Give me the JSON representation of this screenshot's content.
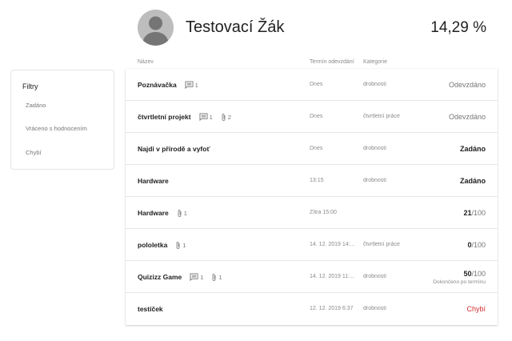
{
  "student": {
    "name": "Testovací Žák",
    "grade_percent": "14,29 %"
  },
  "filters": {
    "title": "Filtry",
    "items": [
      {
        "label": "Zadáno"
      },
      {
        "label": "Vráceno s hodnocením"
      },
      {
        "label": "Chybí"
      }
    ]
  },
  "table": {
    "headers": {
      "name": "Název",
      "due": "Termín odevzdání",
      "category": "Kategorie"
    },
    "rows": [
      {
        "name": "Poznávačka",
        "comments": "1",
        "attachments": "",
        "due": "Dnes",
        "category": "drobnosti",
        "status": "Odevzdáno",
        "status_type": "muted"
      },
      {
        "name": "čtvrtletní projekt",
        "comments": "1",
        "attachments": "2",
        "due": "Dnes",
        "category": "čtvrtletní práce",
        "status": "Odevzdáno",
        "status_type": "muted"
      },
      {
        "name": "Najdi v přírodě a vyfoť",
        "comments": "",
        "attachments": "",
        "due": "Dnes",
        "category": "drobnosti",
        "status": "Zadáno",
        "status_type": "strong"
      },
      {
        "name": "Hardware",
        "comments": "",
        "attachments": "",
        "due": "13:15",
        "category": "drobnosti",
        "status": "Zadáno",
        "status_type": "strong"
      },
      {
        "name": "Hardware",
        "comments": "",
        "attachments": "1",
        "due": "Zítra 15:00",
        "category": "",
        "score": "21",
        "score_max": "/100",
        "status_type": "score"
      },
      {
        "name": "pololetka",
        "comments": "",
        "attachments": "1",
        "due": "14. 12. 2019 14:...",
        "category": "čtvrtletní práce",
        "score": "0",
        "score_max": "/100",
        "status_type": "score"
      },
      {
        "name": "Quizizz Game",
        "comments": "1",
        "attachments": "1",
        "due": "14. 12. 2019 11:...",
        "category": "drobnosti",
        "score": "50",
        "score_max": "/100",
        "status_sub": "Dokončeno po termínu",
        "status_type": "score"
      },
      {
        "name": "testíček",
        "comments": "",
        "attachments": "",
        "due": "12. 12. 2019 6:37",
        "category": "drobnosti",
        "status": "Chybí",
        "status_type": "red"
      }
    ]
  },
  "icons": {
    "comment": "comment-icon",
    "attachment": "paperclip-icon",
    "avatar": "person-avatar-icon"
  },
  "colors": {
    "missing": "#d32f2f",
    "avatar_bg": "#bdbdbd",
    "avatar_fg": "#757575"
  }
}
